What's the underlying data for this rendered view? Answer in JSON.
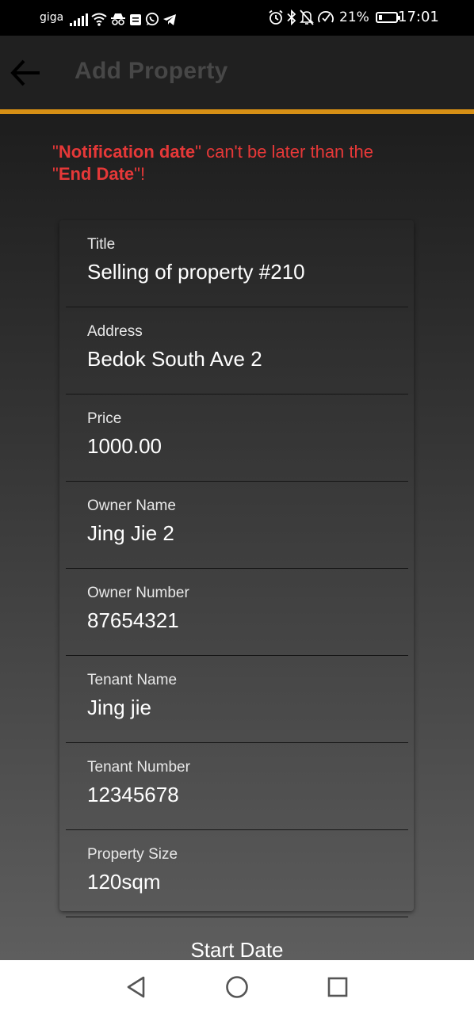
{
  "status_bar": {
    "carrier": "giga",
    "battery_percent": "21%",
    "battery_level": 0.21,
    "time": "17:01",
    "left_icons": [
      "signal-icon",
      "wifi-icon",
      "incognito-icon",
      "notification-icon",
      "whatsapp-icon",
      "telegram-icon"
    ],
    "right_icons": [
      "alarm-icon",
      "bluetooth-icon",
      "do-not-disturb-icon",
      "data-saver-icon",
      "battery-icon"
    ]
  },
  "app_bar": {
    "title": "Add Property",
    "back_icon": "arrow-left-icon"
  },
  "colors": {
    "accent": "#d68f15",
    "error": "#e53838",
    "title_text": "#474747"
  },
  "error": {
    "quote_open": "\"",
    "field1": "Notification date",
    "middle": "\" can't be later than the",
    "quote_open2": "\"",
    "field2": "End Date",
    "tail": "\"!"
  },
  "form": {
    "fields": [
      {
        "label": "Title",
        "value": "Selling of property #210"
      },
      {
        "label": "Address",
        "value": "Bedok South Ave 2"
      },
      {
        "label": "Price",
        "value": "1000.00"
      },
      {
        "label": "Owner Name",
        "value": "Jing Jie 2"
      },
      {
        "label": "Owner Number",
        "value": "87654321"
      },
      {
        "label": "Tenant Name",
        "value": "Jing jie"
      },
      {
        "label": "Tenant Number",
        "value": "12345678"
      },
      {
        "label": "Property Size",
        "value": "120sqm"
      }
    ],
    "start_date_label": "Start Date"
  },
  "nav_bar": {
    "buttons": [
      "back-triangle-icon",
      "home-circle-icon",
      "recents-square-icon"
    ]
  }
}
